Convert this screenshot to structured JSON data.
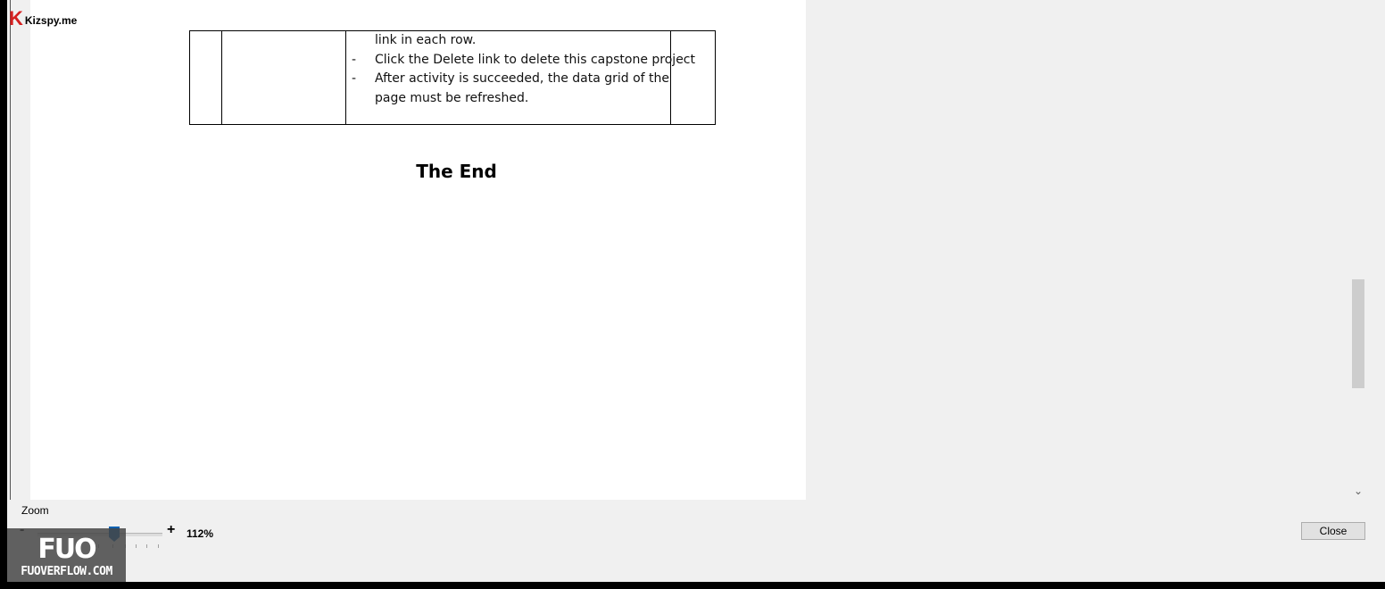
{
  "document": {
    "table_lines": [
      {
        "dash": "",
        "text": "link in each row."
      },
      {
        "dash": "-",
        "text": "Click the Delete link to delete this capstone project"
      },
      {
        "dash": "-",
        "text": "After activity is succeeded, the data grid of the"
      },
      {
        "dash": "",
        "text": "page must be refreshed."
      }
    ],
    "closing_title": "The End"
  },
  "zoom": {
    "label": "Zoom",
    "minus": "-",
    "plus": "+",
    "value_text": "112%",
    "slider_value": 112
  },
  "buttons": {
    "close": "Close"
  },
  "watermarks": {
    "top_logo_letter": "K",
    "top_text": "Kizspy.me",
    "bottom_logo": "FUO",
    "bottom_url": "FUOVERFLOW.COM"
  },
  "icons": {
    "scroll_down": "chevron-down-icon"
  },
  "colors": {
    "slider_thumb": "#0060b0",
    "watermark_k": "#d42020"
  }
}
